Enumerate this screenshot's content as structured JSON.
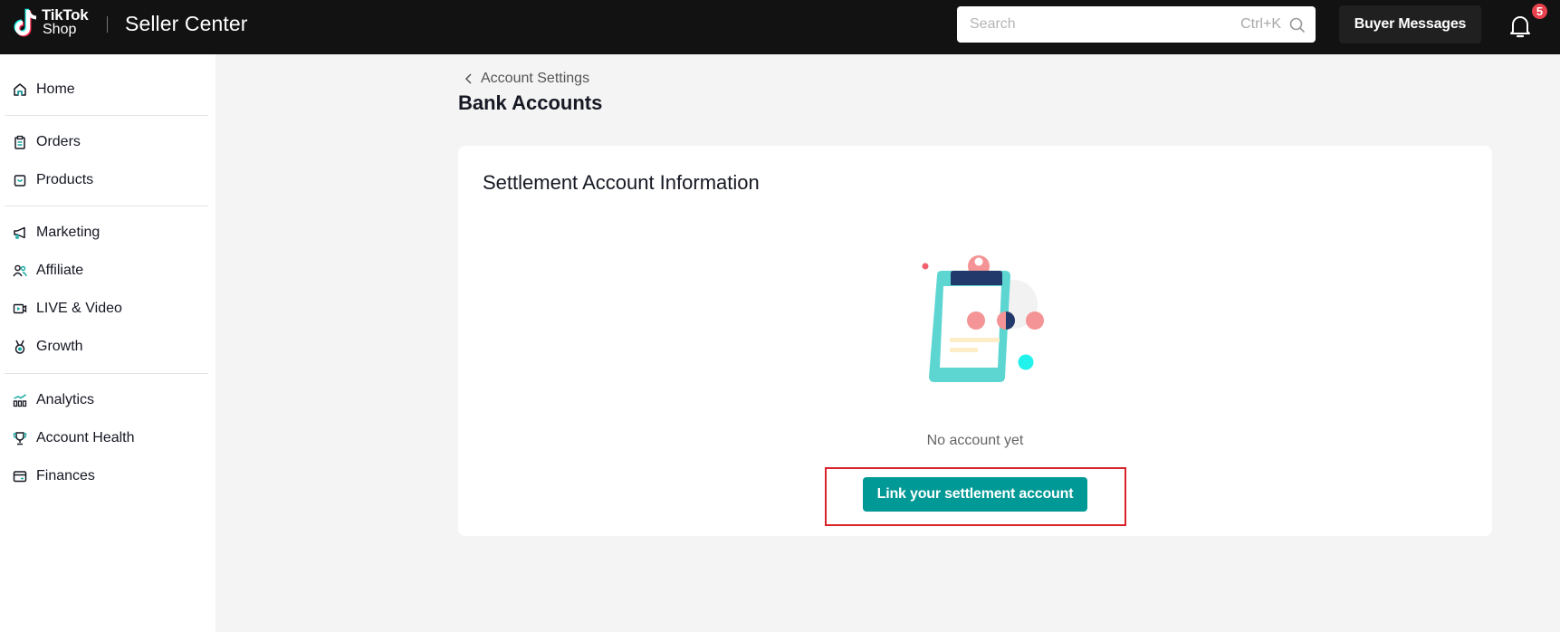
{
  "header": {
    "brand_line1": "TikTok",
    "brand_line2": "Shop",
    "app_title": "Seller Center",
    "search": {
      "placeholder": "Search",
      "value": "",
      "shortcut": "Ctrl+K",
      "icon": "search-icon"
    },
    "buyer_messages_label": "Buyer Messages",
    "notifications": {
      "icon": "bell-icon",
      "count": "5"
    }
  },
  "sidebar": {
    "items": [
      {
        "label": "Home",
        "icon": "home-icon"
      },
      {
        "label": "Orders",
        "icon": "clipboard-icon"
      },
      {
        "label": "Products",
        "icon": "product-box-icon"
      },
      {
        "label": "Marketing",
        "icon": "megaphone-icon"
      },
      {
        "label": "Affiliate",
        "icon": "people-icon"
      },
      {
        "label": "LIVE & Video",
        "icon": "video-camera-icon"
      },
      {
        "label": "Growth",
        "icon": "medal-icon"
      },
      {
        "label": "Analytics",
        "icon": "bar-chart-icon"
      },
      {
        "label": "Account Health",
        "icon": "trophy-icon"
      },
      {
        "label": "Finances",
        "icon": "wallet-card-icon"
      }
    ]
  },
  "main": {
    "breadcrumb": "Account Settings",
    "page_title": "Bank Accounts",
    "card": {
      "title": "Settlement Account Information",
      "empty_text": "No account yet",
      "link_button_label": "Link your settlement account"
    }
  },
  "colors": {
    "header_bg": "#121212",
    "accent": "#009995",
    "highlight": "#d8232a",
    "badge": "#e6414c"
  }
}
